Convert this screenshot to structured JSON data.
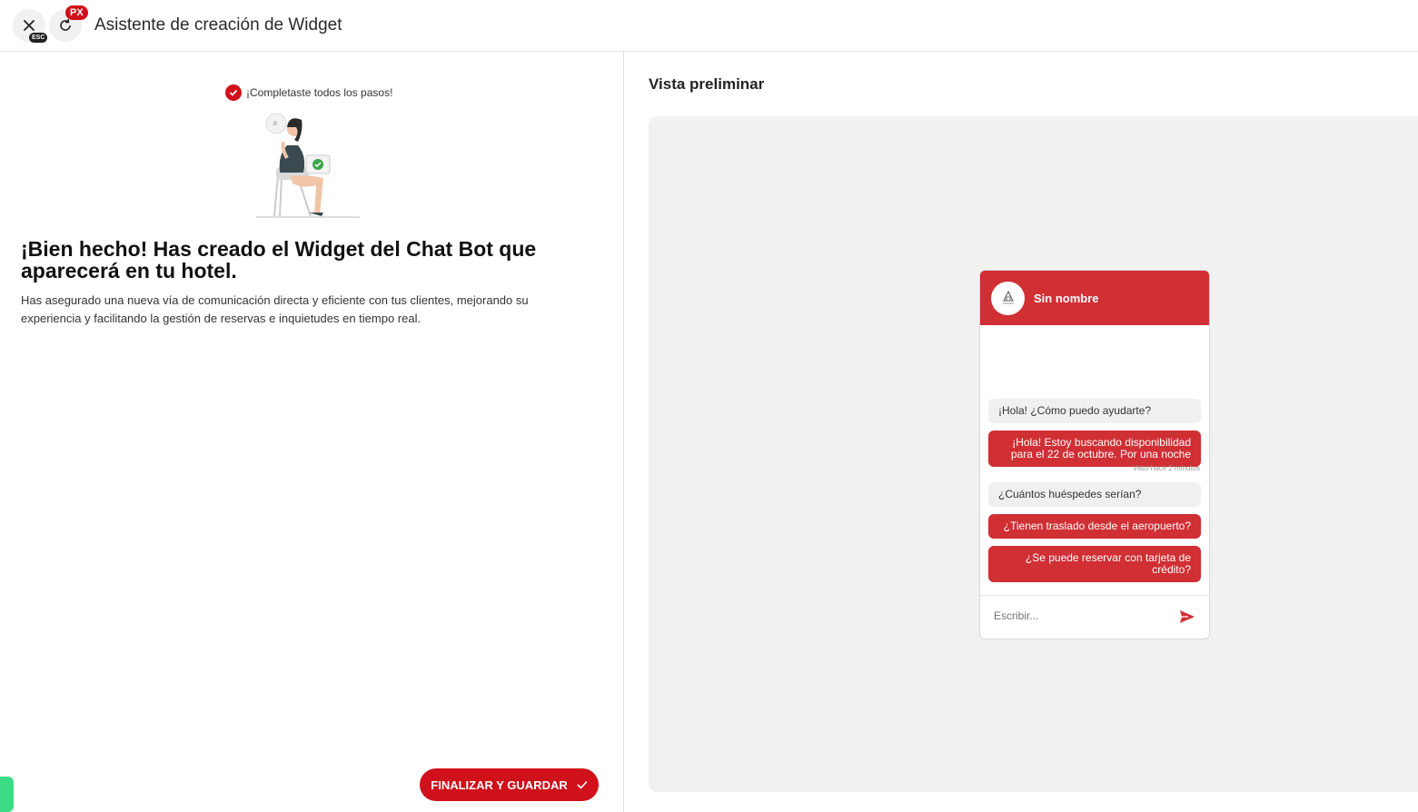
{
  "header": {
    "title": "Asistente de creación de Widget",
    "esc_badge": "ESC",
    "px_badge": "PX"
  },
  "left": {
    "steps_done": "¡Completaste todos los pasos!",
    "headline": "¡Bien hecho! Has creado el Widget del Chat Bot que aparecerá en tu hotel.",
    "description": "Has asegurado una nueva vía de comunicación directa y eficiente con tus clientes, mejorando su experiencia y facilitando la gestión de reservas e inquietudes en tiempo real.",
    "finish_button": "FINALIZAR Y GUARDAR"
  },
  "preview": {
    "title": "Vista preliminar",
    "chat": {
      "name": "Sin nombre",
      "messages": [
        {
          "role": "bot",
          "text": "¡Hola! ¿Cómo puedo ayudarte?"
        },
        {
          "role": "user",
          "text": "¡Hola! Estoy buscando disponibilidad para el 22 de octubre. Por una noche"
        },
        {
          "role": "bot",
          "text": "¿Cuántos huéspedes serían?"
        },
        {
          "role": "user",
          "text": "¿Tienen traslado desde el aeropuerto?"
        },
        {
          "role": "user",
          "text": "¿Se puede reservar con tarjeta de crédito?"
        }
      ],
      "seen_text": "Visto hace 2 minutos",
      "input_placeholder": "Escribir..."
    }
  },
  "colors": {
    "accent": "#d0101a",
    "chat_accent": "#d02f34"
  }
}
